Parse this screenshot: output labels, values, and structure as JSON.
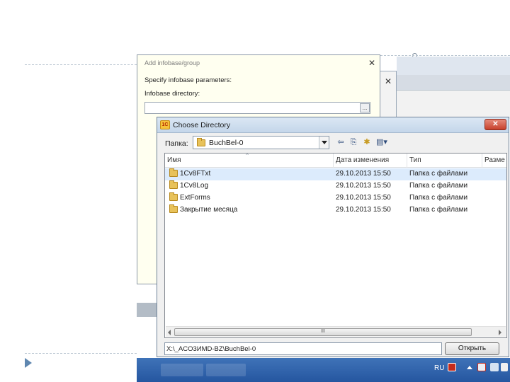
{
  "add_dialog": {
    "title": "Add infobase/group",
    "close_glyph": "✕",
    "params_label": "Specify infobase parameters:",
    "dir_label": "Infobase directory:",
    "dir_value": "",
    "browse_label": "..."
  },
  "chooser": {
    "title": "Choose Directory",
    "app_icon_text": "1C",
    "close_glyph": "✕",
    "folder_label": "Папка:",
    "folder_value": "BuchBel-0",
    "toolbar": {
      "back_icon": "arrow-left-icon",
      "up_icon": "folder-up-icon",
      "new_folder_icon": "new-folder-icon",
      "view_icon": "view-menu-icon"
    },
    "columns": [
      "Имя",
      "Дата изменения",
      "Тип",
      "Разме"
    ],
    "rows": [
      {
        "name": "1Cv8FTxt",
        "date": "29.10.2013 15:50",
        "type": "Папка с файлами",
        "selected": true
      },
      {
        "name": "1Cv8Log",
        "date": "29.10.2013 15:50",
        "type": "Папка с файлами",
        "selected": false
      },
      {
        "name": "ExtForms",
        "date": "29.10.2013 15:50",
        "type": "Папка с файлами",
        "selected": false
      },
      {
        "name": "Закрытие месяца",
        "date": "29.10.2013 15:50",
        "type": "Папка с файлами",
        "selected": false
      }
    ],
    "scroll_thumb_label": "III",
    "path_value": "X:\\_ACO3ИMD-BZ\\BuchBel-0",
    "open_button": "Открыть"
  },
  "taskbar": {
    "language": "RU"
  },
  "colors": {
    "selection": "#dcebfc",
    "taskbar": "#2f63ad",
    "dialog_background": "#fffff0",
    "accent_bullet": "#5f87b0"
  }
}
